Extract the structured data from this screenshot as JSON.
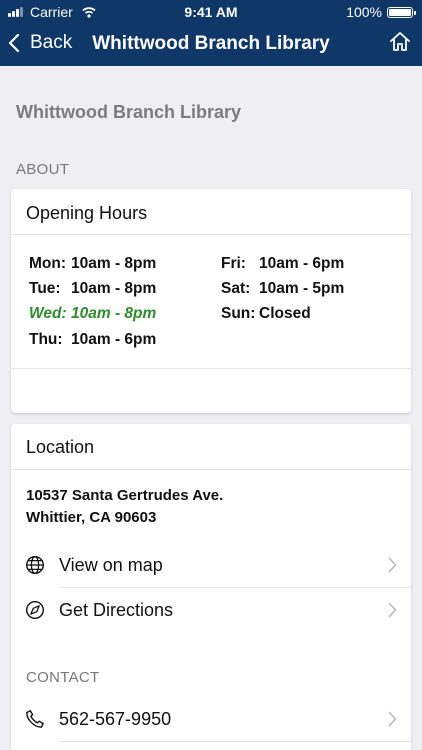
{
  "status_bar": {
    "carrier": "Carrier",
    "time": "9:41 AM",
    "battery": "100%",
    "battery_level": 1.0
  },
  "nav": {
    "back_label": "Back",
    "title": "Whittwood Branch Library",
    "back_icon": "chevron-left-icon",
    "home_icon": "home-icon"
  },
  "page": {
    "heading": "Whittwood Branch Library",
    "section_about": "ABOUT"
  },
  "hours": {
    "title": "Opening Hours",
    "left": [
      {
        "day": "Mon:",
        "time": "10am - 8pm",
        "today": false
      },
      {
        "day": "Tue:",
        "time": "10am - 8pm",
        "today": false
      },
      {
        "day": "Wed:",
        "time": "10am - 8pm",
        "today": true
      },
      {
        "day": "Thu:",
        "time": "10am - 6pm",
        "today": false
      }
    ],
    "right": [
      {
        "day": "Fri:",
        "time": "10am - 6pm",
        "today": false
      },
      {
        "day": "Sat:",
        "time": "10am - 5pm",
        "today": false
      },
      {
        "day": "Sun:",
        "time": "Closed",
        "today": false
      }
    ],
    "today_color": "#2e8b2e"
  },
  "location": {
    "title": "Location",
    "address_line1": "10537 Santa Gertrudes Ave.",
    "address_line2": "Whittier, CA 90603",
    "view_map_label": "View on map",
    "directions_label": "Get Directions",
    "contact_label": "CONTACT",
    "phone": "562-567-9950"
  },
  "colors": {
    "nav_bg": "#0f3768",
    "page_bg": "#eeeef3"
  }
}
